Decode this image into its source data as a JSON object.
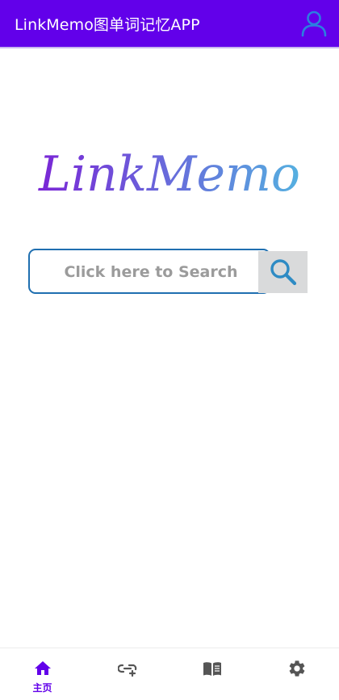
{
  "app_bar": {
    "title": "LinkMemo图单词记忆APP",
    "background": "#6200ea",
    "profile_icon": "person-outline-icon",
    "profile_icon_color": "#2b7fe0"
  },
  "logo": {
    "text": "LinkMemo",
    "gradient_start": "#7a26d6",
    "gradient_end": "#55b0e0"
  },
  "search": {
    "placeholder": "Click here to Search",
    "border_color": "#1f6fb0",
    "button_icon": "search-icon",
    "button_icon_color": "#2e8bc4"
  },
  "bottom_nav": {
    "active_color": "#6200ea",
    "inactive_color": "#555555",
    "items": [
      {
        "icon": "home-icon",
        "label": "主页",
        "active": true
      },
      {
        "icon": "link-add-icon",
        "label": "",
        "active": false
      },
      {
        "icon": "book-icon",
        "label": "",
        "active": false
      },
      {
        "icon": "settings-icon",
        "label": "",
        "active": false
      }
    ]
  }
}
